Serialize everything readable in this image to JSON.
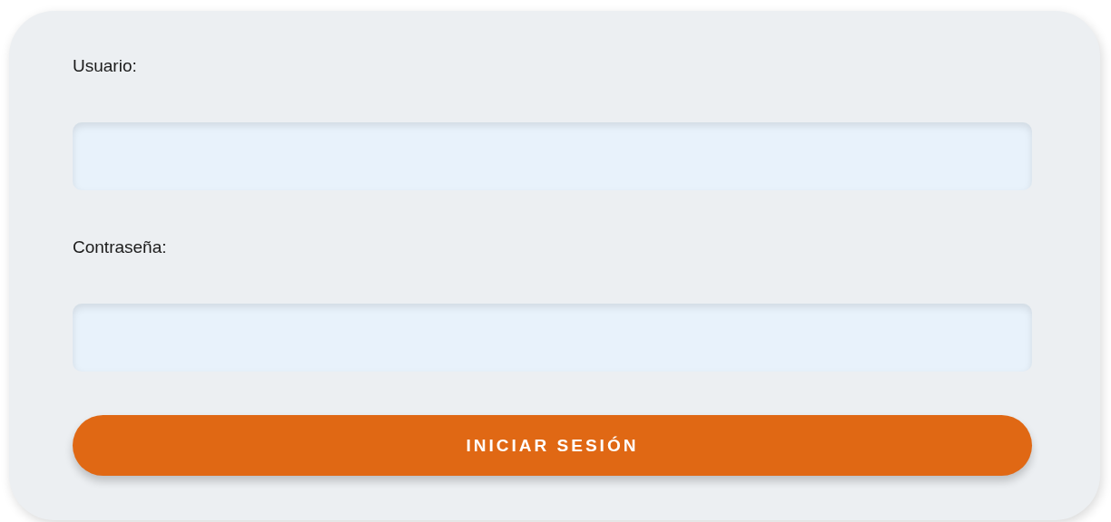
{
  "fields": [
    {
      "label": "Usuario:"
    },
    {
      "label": "Contraseña:"
    }
  ],
  "button": {
    "label": "INICIAR SESIÓN"
  }
}
